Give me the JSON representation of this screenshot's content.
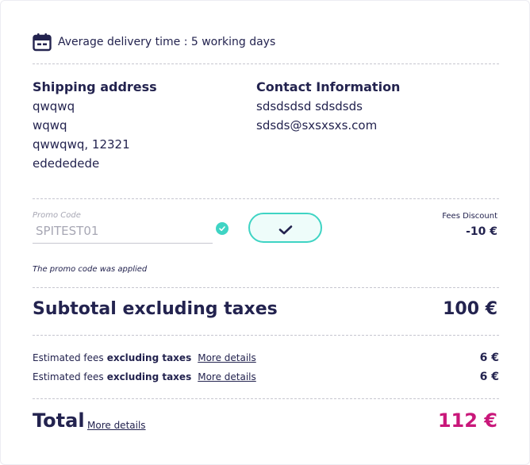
{
  "delivery": {
    "text": "Average delivery time : 5 working days",
    "icon": "calendar-icon"
  },
  "shipping": {
    "title": "Shipping address",
    "lines": [
      "qwqwq",
      "wqwq",
      "qwwqwq, 12321",
      "edededede"
    ]
  },
  "contact": {
    "title": "Contact Information",
    "lines": [
      "sdsdsdsd sdsdsds",
      "sdsds@sxsxsxs.com"
    ]
  },
  "promo": {
    "label": "Promo Code",
    "value": "SPITEST01",
    "note": "The promo code was applied",
    "apply_icon": "check-icon"
  },
  "fees_discount": {
    "label": "Fees Discount",
    "value": "-10 €"
  },
  "subtotal": {
    "label": "Subtotal excluding taxes",
    "value": "100 €"
  },
  "fees": [
    {
      "prefix": "Estimated fees",
      "bold": "excluding taxes",
      "link": "More details",
      "value": "6 €"
    },
    {
      "prefix": "Estimated fees",
      "bold": "excluding taxes",
      "link": "More details",
      "value": "6 €"
    }
  ],
  "total": {
    "label": "Total",
    "link": "More details",
    "value": "112 €"
  },
  "colors": {
    "accent": "#3fd4c4",
    "total": "#c9177a",
    "text": "#23234f"
  }
}
